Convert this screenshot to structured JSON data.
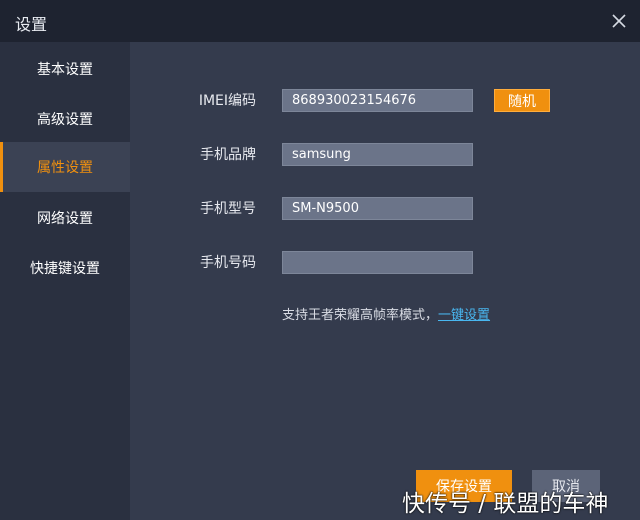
{
  "window": {
    "title": "设置",
    "close_icon": "close-icon"
  },
  "sidebar": {
    "items": [
      {
        "label": "基本设置",
        "active": false
      },
      {
        "label": "高级设置",
        "active": false
      },
      {
        "label": "属性设置",
        "active": true
      },
      {
        "label": "网络设置",
        "active": false
      },
      {
        "label": "快捷键设置",
        "active": false
      }
    ]
  },
  "form": {
    "imei": {
      "label": "IMEI编码",
      "value": "868930023154676"
    },
    "random_button": "随机",
    "brand": {
      "label": "手机品牌",
      "value": "samsung"
    },
    "model": {
      "label": "手机型号",
      "value": "SM-N9500"
    },
    "phone": {
      "label": "手机号码",
      "value": ""
    },
    "tip_text": "支持王者荣耀高帧率模式，",
    "tip_link": "一键设置"
  },
  "footer": {
    "save_label": "保存设置",
    "cancel_label": "取消"
  },
  "watermark": "快传号 / 联盟的车神",
  "colors": {
    "accent": "#f0900f",
    "link": "#49b7f0",
    "background": "#343b4d",
    "sidebar": "#2a3040",
    "titlebar": "#1e2330"
  }
}
